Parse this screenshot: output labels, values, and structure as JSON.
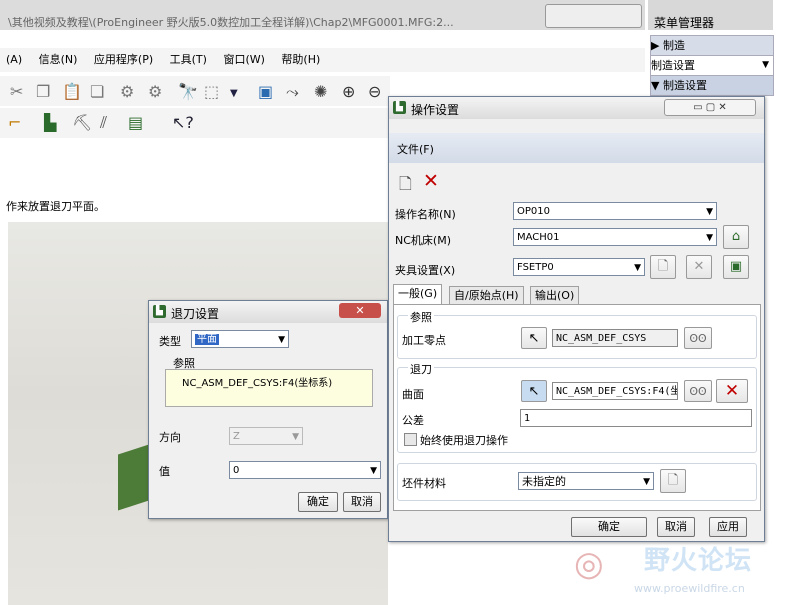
{
  "main": {
    "title": "\\其他视频及教程\\(ProEngineer 野火版5.0数控加工全程详解)\\Chap2\\MFG0001.MFG:2...",
    "menu": [
      "(A)",
      "信息(N)",
      "应用程序(P)",
      "工具(T)",
      "窗口(W)",
      "帮助(H)"
    ],
    "message": "作来放置退刀平面。"
  },
  "right_panel": {
    "header": "菜单管理器",
    "items": [
      "▶ 制造",
      "制造设置",
      "▼ 制造设置"
    ]
  },
  "retract_dialog": {
    "title": "退刀设置",
    "type_label": "类型",
    "type_value": "平面",
    "ref_group": "参照",
    "ref_value": "NC_ASM_DEF_CSYS:F4(坐标系)",
    "direction_label": "方向",
    "direction_value": "Z",
    "value_label": "值",
    "value_value": "0",
    "ok": "确定",
    "cancel": "取消"
  },
  "op_dialog": {
    "title": "操作设置",
    "file_menu": "文件(F)",
    "op_name_label": "操作名称(N)",
    "op_name_value": "OP010",
    "nc_machine_label": "NC机床(M)",
    "nc_machine_value": "MACH01",
    "fixture_label": "夹具设置(X)",
    "fixture_value": "FSETP0",
    "tabs": [
      "一般(G)",
      "自/原始点(H)",
      "输出(O)"
    ],
    "ref_group": "参照",
    "machine_zero_label": "加工零点",
    "machine_zero_value": "NC_ASM_DEF_CSYS",
    "retract_group": "退刀",
    "surface_label": "曲面",
    "surface_value": "NC_ASM_DEF_CSYS:F4(坐",
    "tolerance_label": "公差",
    "tolerance_value": "1",
    "always_retract": "始终使用退刀操作",
    "stock_label": "坯件材料",
    "stock_value": "未指定的",
    "ok": "确定",
    "cancel": "取消",
    "apply": "应用"
  },
  "watermark": {
    "logo": "野火论坛",
    "url": "www.proewildfire.cn"
  }
}
